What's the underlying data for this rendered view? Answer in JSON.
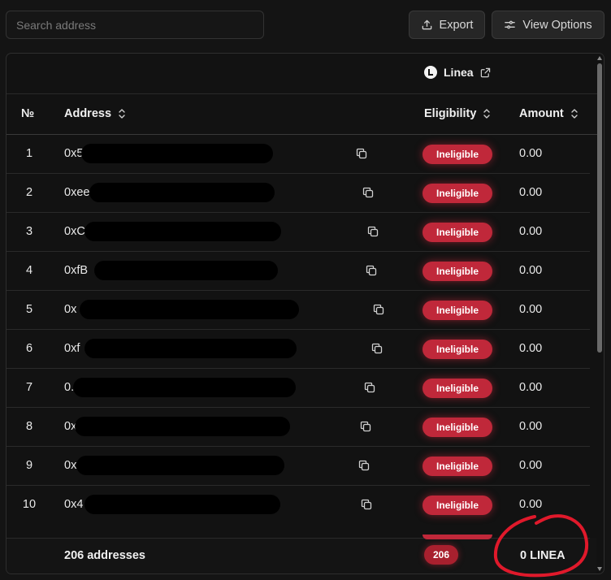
{
  "search": {
    "placeholder": "Search address"
  },
  "toolbar": {
    "export_label": "Export",
    "view_options_label": "View Options"
  },
  "chain": {
    "name": "Linea"
  },
  "columns": {
    "number": "№",
    "address": "Address",
    "eligibility": "Eligibility",
    "amount": "Amount"
  },
  "rows": [
    {
      "n": "1",
      "address_visible": "0x5",
      "eligibility": "Ineligible",
      "amount": "0.00"
    },
    {
      "n": "2",
      "address_visible": "0xee",
      "eligibility": "Ineligible",
      "amount": "0.00"
    },
    {
      "n": "3",
      "address_visible": "0xC",
      "eligibility": "Ineligible",
      "amount": "0.00"
    },
    {
      "n": "4",
      "address_visible": "0xfB",
      "eligibility": "Ineligible",
      "amount": "0.00"
    },
    {
      "n": "5",
      "address_visible": "0x",
      "eligibility": "Ineligible",
      "amount": "0.00"
    },
    {
      "n": "6",
      "address_visible": "0xf",
      "eligibility": "Ineligible",
      "amount": "0.00"
    },
    {
      "n": "7",
      "address_visible": "0.",
      "eligibility": "Ineligible",
      "amount": "0.00"
    },
    {
      "n": "8",
      "address_visible": "0x",
      "eligibility": "Ineligible",
      "amount": "0.00"
    },
    {
      "n": "9",
      "address_visible": "0x",
      "eligibility": "Ineligible",
      "amount": "0.00"
    },
    {
      "n": "10",
      "address_visible": "0x4",
      "eligibility": "Ineligible",
      "amount": "0.00"
    }
  ],
  "footer": {
    "count_label": "206 addresses",
    "eligible_count": "206",
    "total": "0 LINEA"
  },
  "colors": {
    "badge": "#c0283a",
    "annotation": "#e0192b",
    "background": "#141414"
  }
}
